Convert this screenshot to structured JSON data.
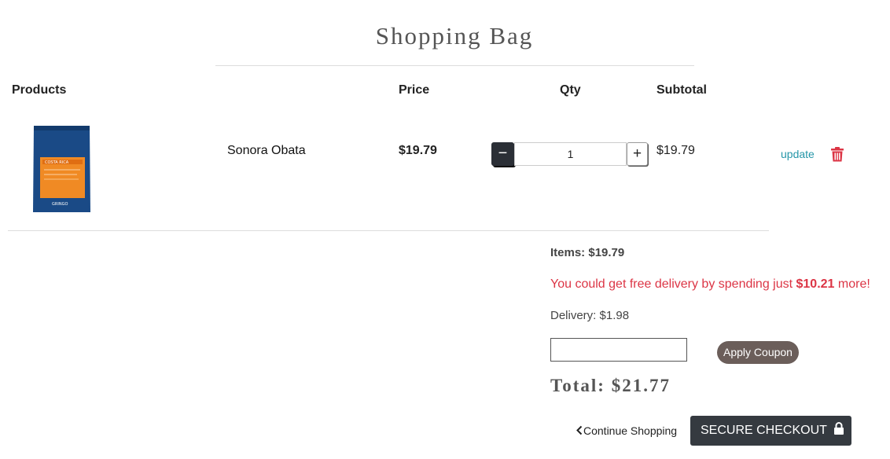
{
  "page": {
    "title": "Shopping Bag"
  },
  "table": {
    "headers": {
      "products": "Products",
      "price": "Price",
      "qty": "Qty",
      "subtotal": "Subtotal"
    }
  },
  "cart_items": [
    {
      "name": "Sonora Obata",
      "price": "$19.79",
      "qty": "1",
      "subtotal": "$19.79",
      "update_label": "update",
      "image_label": "COSTA RICA",
      "image_brand": "GRINGO"
    }
  ],
  "summary": {
    "items": "Items: $19.79",
    "free_delivery_prefix": "You could get free delivery by spending just ",
    "free_delivery_amount": "$10.21",
    "free_delivery_suffix": " more!",
    "delivery": "Delivery: $1.98",
    "coupon_value": "",
    "coupon_button": "Apply Coupon",
    "total": "Total: $21.77"
  },
  "actions": {
    "continue_shopping": "Continue Shopping",
    "checkout": "SECURE CHECKOUT"
  },
  "colors": {
    "accent_link": "#2596a8",
    "alert": "#dc3545",
    "dark_button": "#353a40",
    "coupon_button": "#6b5e5a"
  },
  "icons": {
    "minus": "minus-icon",
    "plus": "plus-icon",
    "trash": "trash-icon",
    "chevron": "chevron-left-icon",
    "lock": "lock-icon"
  }
}
